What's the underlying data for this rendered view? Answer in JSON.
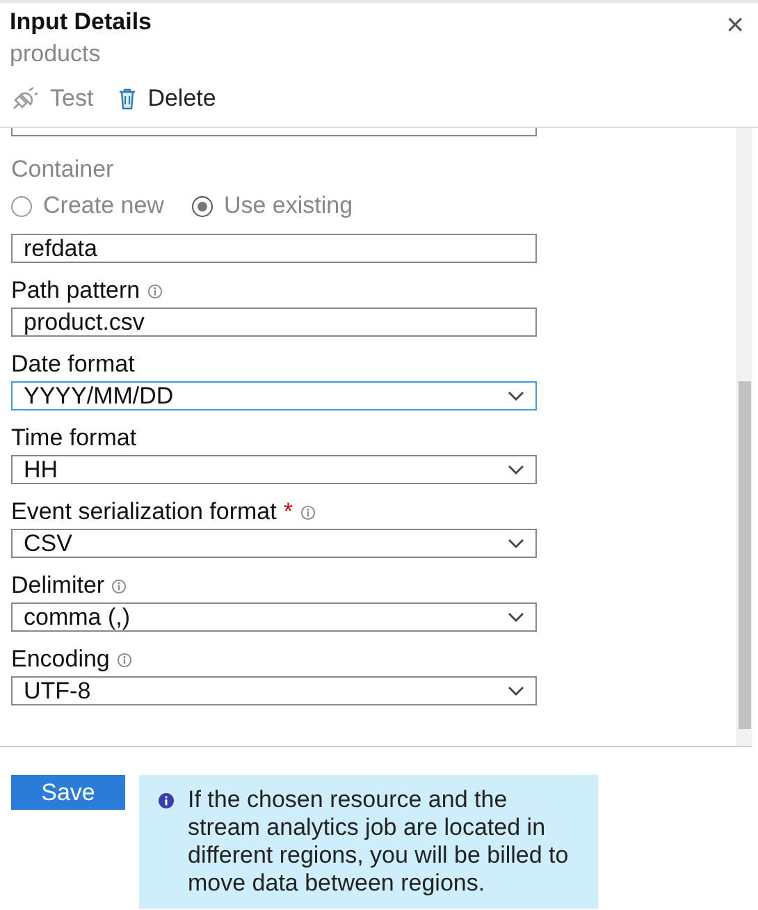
{
  "header": {
    "title": "Input Details",
    "subtitle": "products",
    "close": "×"
  },
  "toolbar": [
    {
      "kind": "test",
      "label": "Test",
      "disabled": true
    },
    {
      "kind": "delete",
      "label": "Delete",
      "disabled": false
    }
  ],
  "form": [
    {
      "kind": "radio",
      "label": "Container",
      "options": [
        {
          "label": "Create new",
          "selected": false
        },
        {
          "label": "Use existing",
          "selected": true
        }
      ]
    },
    {
      "kind": "text",
      "value": "refdata"
    },
    {
      "kind": "text",
      "label": "Path pattern",
      "info": true,
      "value": "product.csv"
    },
    {
      "kind": "dropdown",
      "label": "Date format",
      "value": "YYYY/MM/DD",
      "focused": true
    },
    {
      "kind": "dropdown",
      "label": "Time format",
      "value": "HH",
      "focused": false
    },
    {
      "kind": "dropdown",
      "label": "Event serialization format",
      "required": "*",
      "info": true,
      "value": "CSV",
      "focused": false
    },
    {
      "kind": "dropdown",
      "label": "Delimiter",
      "info": true,
      "value": "comma (,)",
      "focused": false
    },
    {
      "kind": "dropdown",
      "label": "Encoding",
      "info": true,
      "value": "UTF-8",
      "focused": false
    }
  ],
  "save_button": "Save",
  "notice": {
    "text": "If the chosen resource and the stream analytics job are located in different regions, you will be billed to move data between regions."
  }
}
